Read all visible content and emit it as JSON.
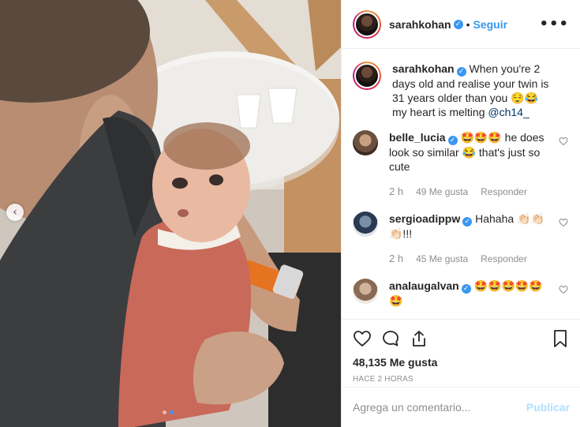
{
  "post": {
    "author": "sarahkohan",
    "verified": true,
    "follow_label": "Seguir",
    "separator": "•",
    "more_label": "•••",
    "caption_prefix": "When you're 2 days old and realise your twin is 31 years older than you 😌😂 my heart is melting ",
    "caption_mention": "@ch14_",
    "carousel": {
      "current_slide": 2,
      "total_slides": 2
    }
  },
  "comments": [
    {
      "user": "belle_lucia",
      "verified": true,
      "text": "🤩🤩🤩 he does look so similar 😂 that's just so cute",
      "time": "2 h",
      "likes": "49 Me gusta",
      "reply": "Responder"
    },
    {
      "user": "sergioadippw",
      "verified": true,
      "text": "Hahaha 👏🏻👏🏻👏🏻!!!",
      "time": "2 h",
      "likes": "45 Me gusta",
      "reply": "Responder"
    },
    {
      "user": "analaugalvan",
      "verified": true,
      "text": "🤩🤩🤩🤩🤩🤩",
      "time": "",
      "likes": "",
      "reply": ""
    }
  ],
  "actions": {
    "likes_count": "48,135 Me gusta",
    "posted_ago": "HACE 2 HORAS"
  },
  "composer": {
    "placeholder": "Agrega un comentario...",
    "publish_label": "Publicar"
  },
  "nav": {
    "prev_icon": "‹"
  },
  "colors": {
    "accent": "#3897f0",
    "muted": "#8e8e8e",
    "publish_disabled": "#b2dffc",
    "like_heart": "#262626"
  },
  "icons": [
    "heart-icon",
    "comment-icon",
    "share-icon",
    "bookmark-icon",
    "verified-icon",
    "more-icon",
    "chevron-left-icon"
  ]
}
